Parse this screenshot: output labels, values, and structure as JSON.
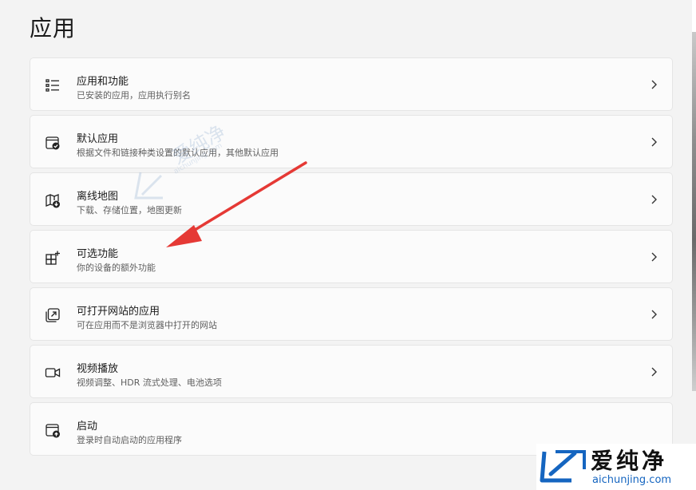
{
  "page": {
    "title": "应用"
  },
  "items": [
    {
      "title": "应用和功能",
      "desc": "已安装的应用，应用执行别名",
      "icon": "apps-list-icon"
    },
    {
      "title": "默认应用",
      "desc": "根据文件和链接种类设置的默认应用，其他默认应用",
      "icon": "default-apps-icon"
    },
    {
      "title": "离线地图",
      "desc": "下载、存储位置，地图更新",
      "icon": "offline-maps-icon"
    },
    {
      "title": "可选功能",
      "desc": "你的设备的额外功能",
      "icon": "optional-features-icon"
    },
    {
      "title": "可打开网站的应用",
      "desc": "可在应用而不是浏览器中打开的网站",
      "icon": "apps-for-websites-icon"
    },
    {
      "title": "视频播放",
      "desc": "视频调整、HDR 流式处理、电池选项",
      "icon": "video-playback-icon"
    },
    {
      "title": "启动",
      "desc": "登录时自动启动的应用程序",
      "icon": "startup-icon"
    }
  ],
  "watermark": {
    "brand": "爱纯净",
    "url": "aichunjing.com"
  },
  "colors": {
    "arrow": "#e53935",
    "watermark_blue": "#1565c0"
  }
}
